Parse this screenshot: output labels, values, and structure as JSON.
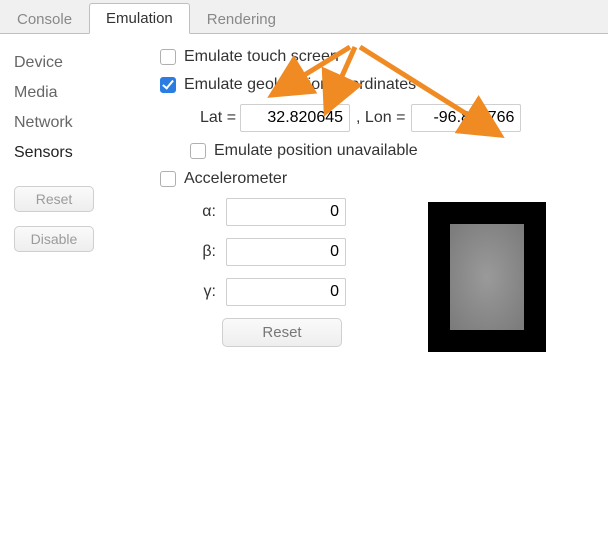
{
  "tabs": {
    "console": "Console",
    "emulation": "Emulation",
    "rendering": "Rendering"
  },
  "sidebar": {
    "items": [
      "Device",
      "Media",
      "Network",
      "Sensors"
    ],
    "reset": "Reset",
    "disable": "Disable"
  },
  "sensors": {
    "emulate_touch": "Emulate touch screen",
    "emulate_geo": "Emulate geolocation coordinates",
    "lat_label": "Lat =",
    "lat_value": "32.820645",
    "lon_label": ", Lon =",
    "lon_value": "-96.871766",
    "pos_unavailable": "Emulate position unavailable",
    "accelerometer": "Accelerometer",
    "alpha_label": "α:",
    "beta_label": "β:",
    "gamma_label": "γ:",
    "alpha": "0",
    "beta": "0",
    "gamma": "0",
    "reset": "Reset"
  },
  "colors": {
    "accent": "#2b7de1",
    "arrow": "#f08b24"
  }
}
